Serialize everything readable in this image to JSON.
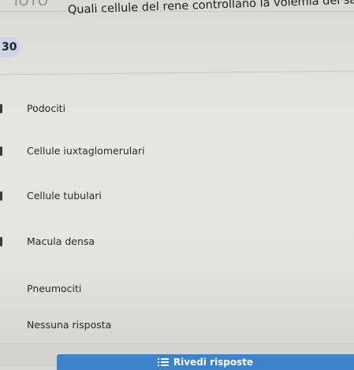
{
  "header": {
    "partial_title": "ΙΟΤΟ"
  },
  "question": {
    "number": "30",
    "text": "Quali cellule del rene controllano la volemia del sangue?"
  },
  "options": [
    {
      "label": "Podociti"
    },
    {
      "label": "Cellule iuxtaglomerulari"
    },
    {
      "label": "Cellule tubulari"
    },
    {
      "label": "Macula densa"
    },
    {
      "label": "Pneumociti"
    },
    {
      "label": "Nessuna risposta"
    }
  ],
  "footer": {
    "review_label": "Rivedi risposte",
    "review_icon": "list-icon"
  },
  "colors": {
    "accent": "#3d82c8",
    "badge": "#cfd3e6"
  }
}
